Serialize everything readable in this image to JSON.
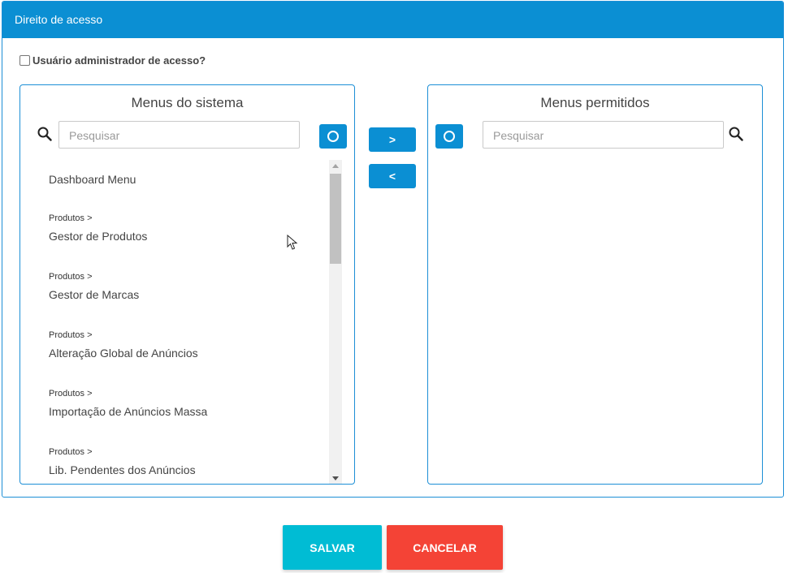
{
  "header": {
    "title": "Direito de acesso"
  },
  "admin": {
    "label": "Usuário administrador de acesso?",
    "checked": false
  },
  "left_box": {
    "title": "Menus do sistema",
    "search_placeholder": "Pesquisar",
    "items": [
      {
        "crumb": "",
        "name": "Dashboard Menu"
      },
      {
        "crumb": "Produtos >",
        "name": "Gestor de Produtos"
      },
      {
        "crumb": "Produtos >",
        "name": "Gestor de Marcas"
      },
      {
        "crumb": "Produtos >",
        "name": "Alteração Global de Anúncios"
      },
      {
        "crumb": "Produtos >",
        "name": "Importação de Anúncios Massa"
      },
      {
        "crumb": "Produtos >",
        "name": "Lib. Pendentes dos Anúncios"
      }
    ]
  },
  "right_box": {
    "title": "Menus permitidos",
    "search_placeholder": "Pesquisar"
  },
  "move_buttons": {
    "right_label": ">",
    "left_label": "<"
  },
  "actions": {
    "save_label": "SALVAR",
    "cancel_label": "CANCELAR"
  },
  "colors": {
    "primary": "#0b8fd3",
    "save": "#00bcd4",
    "cancel": "#f44336"
  }
}
